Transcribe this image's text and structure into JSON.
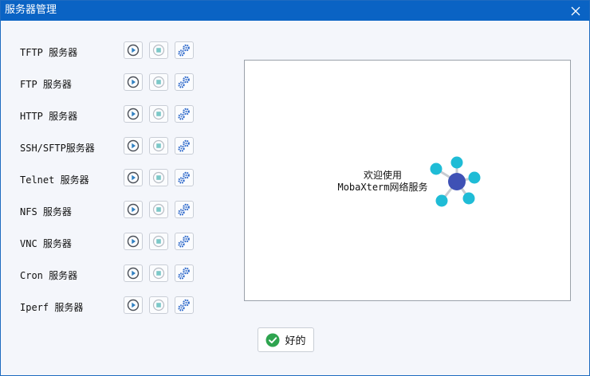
{
  "window": {
    "title": "服务器管理"
  },
  "servers": [
    {
      "label": "TFTP 服务器"
    },
    {
      "label": "FTP 服务器"
    },
    {
      "label": "HTTP 服务器"
    },
    {
      "label": "SSH/SFTP服务器"
    },
    {
      "label": "Telnet 服务器"
    },
    {
      "label": "NFS 服务器"
    },
    {
      "label": "VNC 服务器"
    },
    {
      "label": "Cron 服务器"
    },
    {
      "label": "Iperf 服务器"
    }
  ],
  "panel": {
    "welcome_line1": "欢迎使用",
    "welcome_line2": "MobaXterm网络服务"
  },
  "footer": {
    "ok_label": "好的"
  },
  "icons": {
    "start": "play-circle-icon",
    "stop": "stop-square-icon",
    "config": "gears-icon",
    "ok": "check-circle-icon",
    "close": "close-icon",
    "network": "network-hub-icon"
  },
  "colors": {
    "titlebar": "#0a63c4",
    "play": "#2f7fc1",
    "stop": "#7cc8c8",
    "gear": "#2a66c9",
    "hub": "#3f51b5",
    "node": "#1fbcd6",
    "ok": "#2ea44f"
  }
}
